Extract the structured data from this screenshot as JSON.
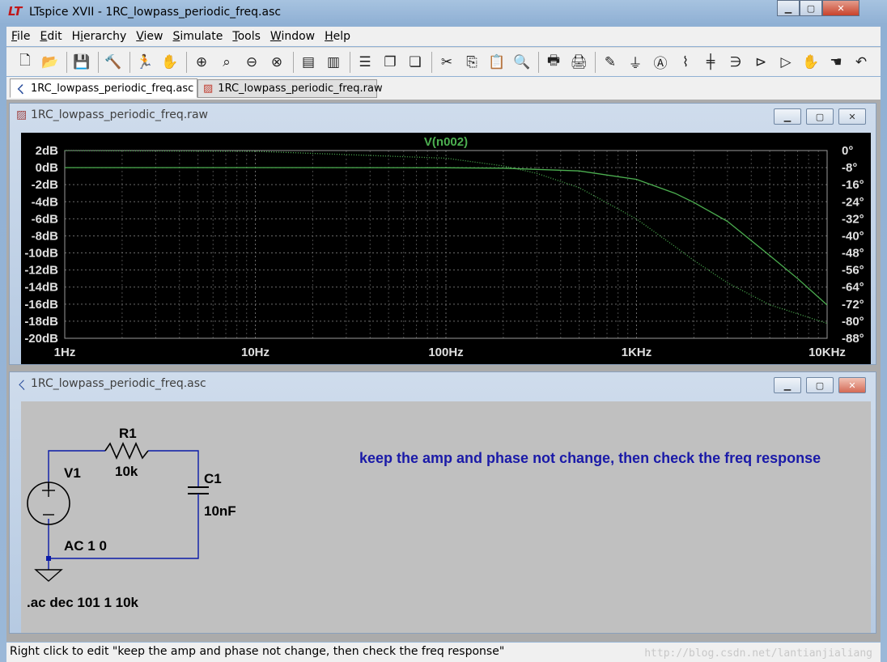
{
  "window": {
    "title": "LTspice XVII - 1RC_lowpass_periodic_freq.asc",
    "app_icon": "ltspice-logo-icon"
  },
  "menu": [
    {
      "label": "File",
      "mnemonic_index": 0
    },
    {
      "label": "Edit",
      "mnemonic_index": 0
    },
    {
      "label": "Hierarchy",
      "mnemonic_index": 1
    },
    {
      "label": "View",
      "mnemonic_index": 0
    },
    {
      "label": "Simulate",
      "mnemonic_index": 0
    },
    {
      "label": "Tools",
      "mnemonic_index": 0
    },
    {
      "label": "Window",
      "mnemonic_index": 0
    },
    {
      "label": "Help",
      "mnemonic_index": 0
    }
  ],
  "toolbar": [
    {
      "icon": "new-schematic-icon",
      "glyph": "🗋"
    },
    {
      "icon": "open-icon",
      "glyph": "📂"
    },
    {
      "sep": true
    },
    {
      "icon": "save-icon",
      "glyph": "💾"
    },
    {
      "sep": true
    },
    {
      "icon": "control-panel-icon",
      "glyph": "🔨"
    },
    {
      "sep": true
    },
    {
      "icon": "run-icon",
      "glyph": "🏃"
    },
    {
      "icon": "halt-icon",
      "glyph": "✋"
    },
    {
      "sep": true
    },
    {
      "icon": "zoom-in-icon",
      "glyph": "⊕"
    },
    {
      "icon": "pan-icon",
      "glyph": "⌕"
    },
    {
      "icon": "zoom-out-icon",
      "glyph": "⊖"
    },
    {
      "icon": "zoom-fit-icon",
      "glyph": "⊗"
    },
    {
      "sep": true
    },
    {
      "icon": "autorange-icon",
      "glyph": "▤"
    },
    {
      "icon": "delete-trace-icon",
      "glyph": "▥"
    },
    {
      "sep": true
    },
    {
      "icon": "tile-horizontal-icon",
      "glyph": "☰"
    },
    {
      "icon": "cascade-icon",
      "glyph": "❐"
    },
    {
      "icon": "tile-vertical-icon",
      "glyph": "❏"
    },
    {
      "sep": true
    },
    {
      "icon": "cut-icon",
      "glyph": "✂"
    },
    {
      "icon": "copy-icon",
      "glyph": "⎘"
    },
    {
      "icon": "paste-icon",
      "glyph": "📋"
    },
    {
      "icon": "find-icon",
      "glyph": "🔍"
    },
    {
      "sep": true
    },
    {
      "icon": "print-icon",
      "glyph": "🖶"
    },
    {
      "icon": "print-setup-icon",
      "glyph": "🖨"
    },
    {
      "sep": true
    },
    {
      "icon": "wire-icon",
      "glyph": "✎"
    },
    {
      "icon": "ground-icon",
      "glyph": "⏚"
    },
    {
      "icon": "label-net-icon",
      "glyph": "Ⓐ"
    },
    {
      "icon": "resistor-icon",
      "glyph": "⌇"
    },
    {
      "icon": "capacitor-icon",
      "glyph": "╪"
    },
    {
      "icon": "inductor-icon",
      "glyph": "∋"
    },
    {
      "icon": "diode-icon",
      "glyph": "⊳"
    },
    {
      "icon": "component-icon",
      "glyph": "▷"
    },
    {
      "icon": "move-icon",
      "glyph": "✋"
    },
    {
      "icon": "drag-icon",
      "glyph": "☚"
    },
    {
      "icon": "undo-icon",
      "glyph": "↶"
    }
  ],
  "tabs": [
    {
      "label": "1RC_lowpass_periodic_freq.asc",
      "icon": "schematic-icon",
      "active": true
    },
    {
      "label": "1RC_lowpass_periodic_freq.raw",
      "icon": "waveform-icon",
      "active": false
    }
  ],
  "plot_window": {
    "title": "1RC_lowpass_periodic_freq.raw",
    "icon": "waveform-icon"
  },
  "schematic_window": {
    "title": "1RC_lowpass_periodic_freq.asc",
    "icon": "schematic-icon"
  },
  "chart_data": {
    "type": "line",
    "title": "V(n002)",
    "x_scale": "log",
    "x_ticks": [
      "1Hz",
      "10Hz",
      "100Hz",
      "1KHz",
      "10KHz"
    ],
    "x_range_hz": [
      1,
      10000
    ],
    "y_left_ticks": [
      "2dB",
      "0dB",
      "-2dB",
      "-4dB",
      "-6dB",
      "-8dB",
      "-10dB",
      "-12dB",
      "-14dB",
      "-16dB",
      "-18dB",
      "-20dB"
    ],
    "y_left_range_db": [
      -20,
      2
    ],
    "y_right_ticks": [
      "0°",
      "-8°",
      "-16°",
      "-24°",
      "-32°",
      "-40°",
      "-48°",
      "-56°",
      "-64°",
      "-72°",
      "-80°",
      "-88°"
    ],
    "y_right_range_deg": [
      -88,
      0
    ],
    "grid": true,
    "trace_color": "#4caf50",
    "series": [
      {
        "kind": "magnitude_db",
        "x": [
          1,
          10,
          100,
          200,
          500,
          1000,
          1592,
          2000,
          3000,
          5000,
          7000,
          10000
        ],
        "y": [
          0,
          0,
          -0.02,
          -0.07,
          -0.39,
          -1.38,
          -3.01,
          -4.09,
          -6.3,
          -10.3,
          -13.0,
          -16.1
        ]
      },
      {
        "kind": "phase_deg",
        "x": [
          1,
          10,
          100,
          200,
          300,
          500,
          1000,
          1592,
          2000,
          3000,
          5000,
          10000
        ],
        "y": [
          -0.04,
          -0.36,
          -3.6,
          -7.2,
          -10.7,
          -17.4,
          -32.1,
          -45.0,
          -51.5,
          -62.0,
          -72.3,
          -81.0
        ]
      }
    ]
  },
  "schematic": {
    "components": {
      "r1_name": "R1",
      "r1_value": "10k",
      "c1_name": "C1",
      "c1_value": "10nF",
      "v1_name": "V1",
      "v1_value": "AC 1 0"
    },
    "directive": ".ac dec 101 1 10k",
    "comment": "keep the amp and phase not change, then check the freq response",
    "wire_color": "#0a1aa8",
    "comment_color": "#1a1aa8"
  },
  "status": {
    "text": "Right click to edit \"keep the amp and phase not change, then check the freq response\"",
    "watermark": "http://blog.csdn.net/lantianjialiang"
  }
}
